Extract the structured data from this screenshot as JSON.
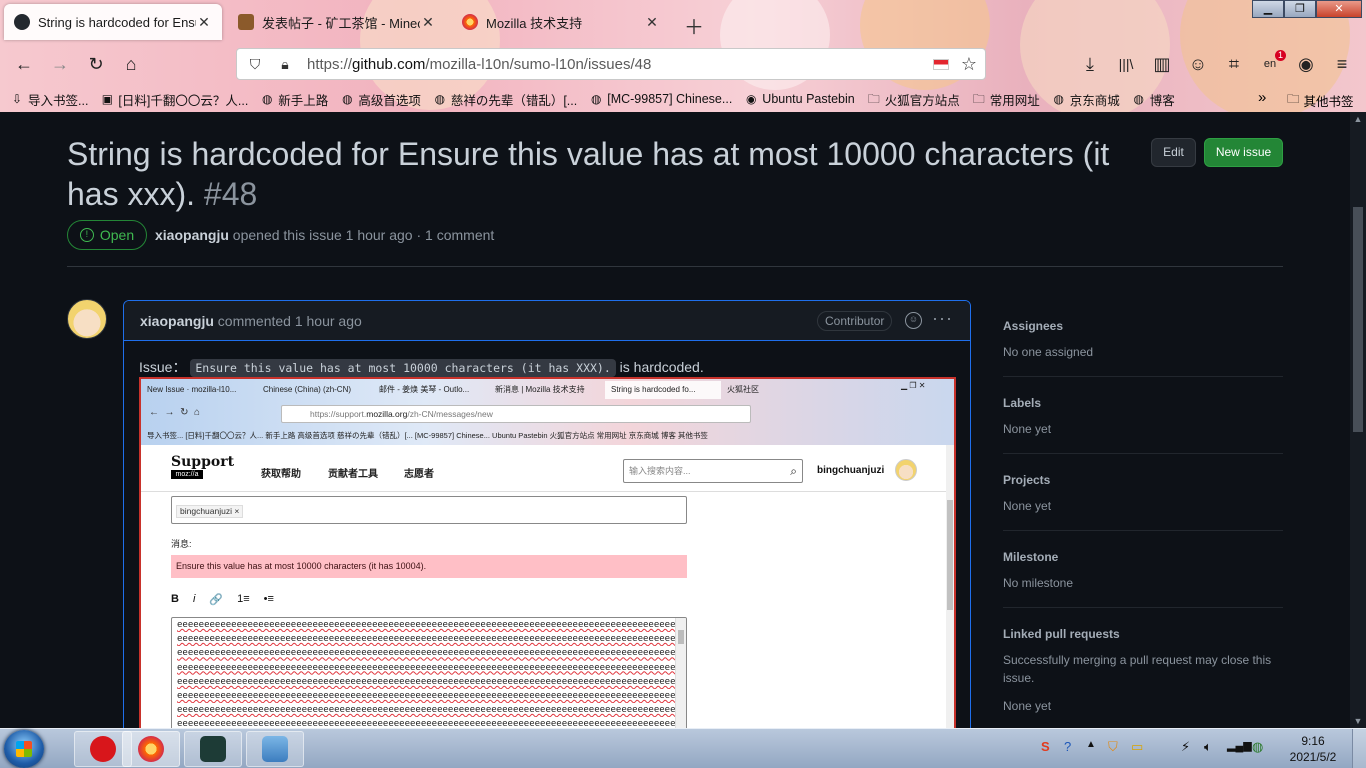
{
  "browser": {
    "tabs": [
      {
        "title": "String is hardcoded for Ensure",
        "color": "#24292f",
        "active": true
      },
      {
        "title": "发表帖子 - 矿工茶馆 - Minec",
        "color": "#8b5a2b",
        "active": false
      },
      {
        "title": "Mozilla 技术支持",
        "color": "#ff6a00",
        "active": false
      }
    ],
    "url_prefix": "https://",
    "url_host": "github.com",
    "url_path": "/mozilla-l10n/sumo-l10n/issues/48",
    "ext_badge": "1",
    "bookmarks": [
      {
        "label": "导入书签...",
        "icon": "import-icon"
      },
      {
        "label": "[日料]千翻〇〇云？人...",
        "icon": "bilibili-icon"
      },
      {
        "label": "新手上路",
        "icon": "globe-icon"
      },
      {
        "label": "高级首选项",
        "icon": "globe-icon"
      },
      {
        "label": "慈祥の先辈（错乱）[...",
        "icon": "globe-icon"
      },
      {
        "label": "[MC-99857] Chinese...",
        "icon": "globe-icon"
      },
      {
        "label": "Ubuntu Pastebin",
        "icon": "ubuntu-icon"
      },
      {
        "label": "火狐官方站点",
        "icon": "folder-icon"
      },
      {
        "label": "常用网址",
        "icon": "folder-icon"
      },
      {
        "label": "京东商城",
        "icon": "globe-icon"
      },
      {
        "label": "博客",
        "icon": "globe-icon"
      }
    ],
    "bookmarks_other": "其他书签"
  },
  "issue": {
    "title": "String is hardcoded for Ensure this value has at most 10000 characters (it has xxx).",
    "number": "#48",
    "edit_label": "Edit",
    "new_issue_label": "New issue",
    "state": "Open",
    "author": "xiaopangju",
    "meta_rest": "opened this issue 1 hour ago · 1 comment"
  },
  "comment": {
    "author": "xiaopangju",
    "action": "commented 1 hour ago",
    "role_badge": "Contributor",
    "body_prefix": "Issue：",
    "body_code": "Ensure this value has at most 10000 characters (it has XXX).",
    "body_suffix": "is hardcoded."
  },
  "screenshot": {
    "tabs": [
      "New Issue · mozilla-l10...",
      "Chinese (China) (zh-CN)",
      "邮件 - 姜焕 美琴 - Outlo...",
      "新消息 | Mozilla 技术支持",
      "String is hardcoded fo...",
      "火狐社区"
    ],
    "url_prefix": "https://support.",
    "url_host": "mozilla.org",
    "url_path": "/zh-CN/messages/new",
    "bookmarks": "导入书签...  [日料]千翻〇〇云？人...  新手上路  高级首选项  慈祥の先辈（错乱）[...  [MC-99857] Chinese...  Ubuntu Pastebin  火狐官方站点  常用网址  京东商城  博客  其他书签",
    "logo_top": "Support",
    "logo_bottom": "moz://a",
    "menu": [
      "获取帮助",
      "贡献者工具",
      "志愿者"
    ],
    "search_placeholder": "输入搜索内容...",
    "username": "bingchuanjuzi",
    "recipient_chip": "bingchuanjuzi ×",
    "message_label": "消息:",
    "error": "Ensure this value has at most 10000 characters (it has 10004).",
    "toolbar": [
      "B",
      "i",
      "🔗",
      "1≡",
      "•≡"
    ],
    "textarea_line": "eeeeeeeeeeeeeeeeeeeeeeeeeeeeeeeeeeeeeeeeeeeeeeeeeeeeeeeeeeeeeeeeeeeeeeeeeeeeeeeeeeeeeeeeeeeeeeeee"
  },
  "sidebar": [
    {
      "heading": "Assignees",
      "value": "No one assigned"
    },
    {
      "heading": "Labels",
      "value": "None yet"
    },
    {
      "heading": "Projects",
      "value": "None yet"
    },
    {
      "heading": "Milestone",
      "value": "No milestone"
    },
    {
      "heading": "Linked pull requests",
      "value": "Successfully merging a pull request may close this issue.",
      "value2": "None yet"
    }
  ],
  "taskbar": {
    "time": "9:16",
    "date": "2021/5/2"
  }
}
